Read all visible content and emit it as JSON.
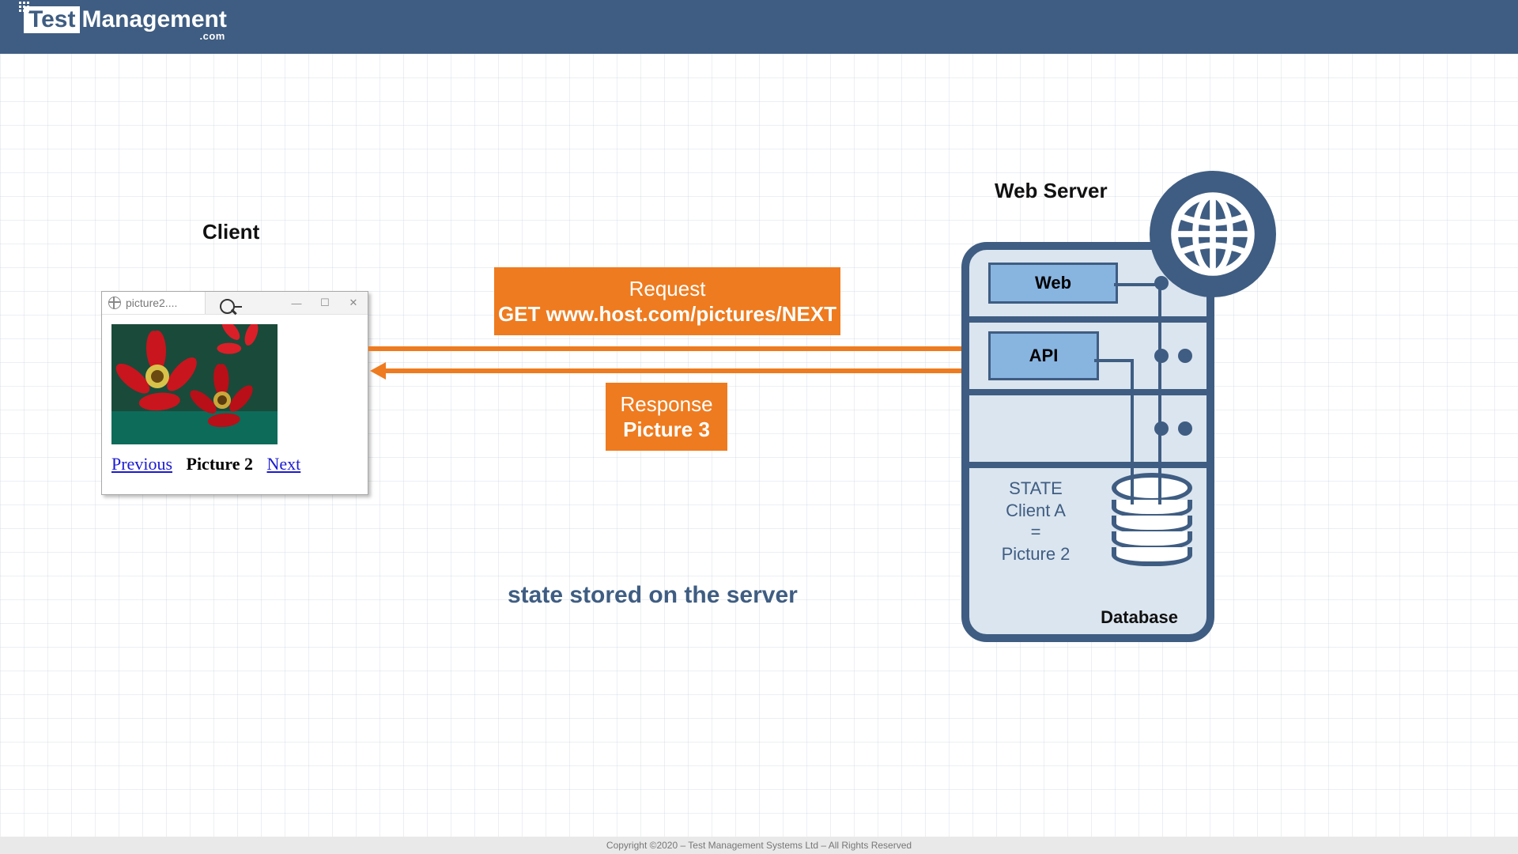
{
  "header": {
    "brand_boxed": "Test",
    "brand_rest": "Management",
    "brand_suffix": ".com"
  },
  "labels": {
    "client": "Client",
    "web_server": "Web Server"
  },
  "client_window": {
    "tab_title": "picture2....",
    "prev": "Previous",
    "current": "Picture 2",
    "next": "Next"
  },
  "request": {
    "line1": "Request",
    "line2": "GET www.host.com/pictures/NEXT"
  },
  "response": {
    "line1": "Response",
    "line2": "Picture 3"
  },
  "annotation": "state stored on the server",
  "server": {
    "web_chip": "Web",
    "api_chip": "API",
    "state_l1": "STATE",
    "state_l2": "Client A",
    "state_l3": "=",
    "state_l4": "Picture 2",
    "db_label": "Database"
  },
  "footer": "Copyright ©2020 – Test Management Systems Ltd – All Rights Reserved"
}
